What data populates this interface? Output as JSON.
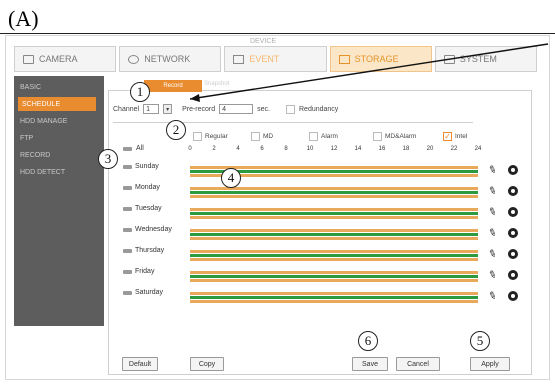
{
  "figure_label": "(A)",
  "app_title": "DEVICE",
  "top_tabs": [
    {
      "label": "CAMERA",
      "icon": "camera-icon",
      "active": false
    },
    {
      "label": "NETWORK",
      "icon": "network-icon",
      "active": false
    },
    {
      "label": "EVENT",
      "icon": "event-icon",
      "active": false
    },
    {
      "label": "STORAGE",
      "icon": "storage-icon",
      "active": true
    },
    {
      "label": "SYSTEM",
      "icon": "system-icon",
      "active": false
    }
  ],
  "sidebar": {
    "items": [
      {
        "label": "BASIC"
      },
      {
        "label": "SCHEDULE",
        "active": true
      },
      {
        "label": "HDD MANAGE"
      },
      {
        "label": "FTP"
      },
      {
        "label": "RECORD"
      },
      {
        "label": "HDD DETECT"
      }
    ]
  },
  "subtabs": {
    "active": "Record",
    "other": "Snapshot"
  },
  "form": {
    "channel_label": "Channel",
    "channel_value": "1",
    "prerecord_label": "Pre-record",
    "prerecord_value": "4",
    "prerecord_unit": "sec.",
    "redundancy_label": "Redundancy"
  },
  "legend": [
    {
      "label": "Regular",
      "checked": false
    },
    {
      "label": "MD",
      "checked": false
    },
    {
      "label": "Alarm",
      "checked": false
    },
    {
      "label": "MD&Alarm",
      "checked": false
    },
    {
      "label": "Intel",
      "checked": true
    }
  ],
  "hour_ticks": [
    "0",
    "2",
    "4",
    "6",
    "8",
    "10",
    "12",
    "14",
    "16",
    "18",
    "20",
    "22",
    "24"
  ],
  "all_label": "All",
  "days": [
    "Sunday",
    "Monday",
    "Tuesday",
    "Wednesday",
    "Thursday",
    "Friday",
    "Saturday"
  ],
  "buttons": {
    "default": "Default",
    "copy": "Copy",
    "save": "Save",
    "cancel": "Cancel",
    "apply": "Apply"
  },
  "callouts": {
    "c1": "1",
    "c2": "2",
    "c3": "3",
    "c4": "4",
    "c5": "5",
    "c6": "6"
  },
  "colors": {
    "accent": "#e98b2f",
    "schedule_orange": "#e8a95a",
    "schedule_green": "#2c9a3e",
    "sidebar_bg": "#5d5d5d"
  }
}
